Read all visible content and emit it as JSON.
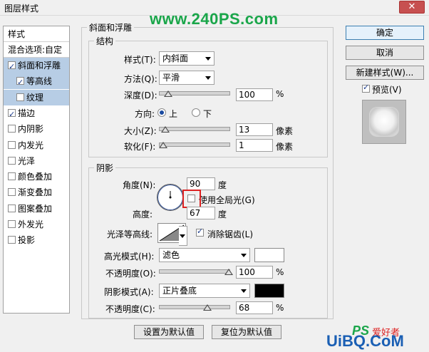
{
  "window": {
    "title": "图层样式",
    "close_label": "✕",
    "watermark_top": "www.240PS.com"
  },
  "left_panel": {
    "header": "样式",
    "blend_options": "混合选项:自定",
    "items": [
      {
        "label": "斜面和浮雕",
        "checked": true,
        "selected": true
      },
      {
        "label": "等高线",
        "checked": true,
        "selected": true
      },
      {
        "label": "纹理",
        "checked": false,
        "selected": true
      },
      {
        "label": "描边",
        "checked": true
      },
      {
        "label": "内阴影",
        "checked": false
      },
      {
        "label": "内发光",
        "checked": false
      },
      {
        "label": "光泽",
        "checked": false
      },
      {
        "label": "颜色叠加",
        "checked": false
      },
      {
        "label": "渐变叠加",
        "checked": false
      },
      {
        "label": "图案叠加",
        "checked": false
      },
      {
        "label": "外发光",
        "checked": false
      },
      {
        "label": "投影",
        "checked": false
      }
    ]
  },
  "bevel": {
    "group_title": "斜面和浮雕",
    "structure_title": "结构",
    "style_label": "样式(T):",
    "style_value": "内斜面",
    "technique_label": "方法(Q):",
    "technique_value": "平滑",
    "depth_label": "深度(D):",
    "depth_value": "100",
    "depth_unit": "%",
    "depth_level": 0.1,
    "direction_label": "方向:",
    "direction_up": "上",
    "direction_down": "下",
    "size_label": "大小(Z):",
    "size_value": "13",
    "size_unit": "像素",
    "size_level": 0.05,
    "soften_label": "软化(F):",
    "soften_value": "1",
    "soften_unit": "像素",
    "soften_level": 0.02
  },
  "shading": {
    "title": "阴影",
    "angle_label": "角度(N):",
    "angle_value": "90",
    "angle_unit": "度",
    "global_light_label": "使用全局光(G)",
    "altitude_label": "高度:",
    "altitude_value": "67",
    "altitude_unit": "度",
    "gloss_label": "光泽等高线:",
    "antialias_label": "消除锯齿(L)",
    "highlight_mode_label": "高光模式(H):",
    "highlight_mode_value": "滤色",
    "highlight_color": "#ffffff",
    "highlight_opacity_label": "不透明度(O):",
    "highlight_opacity_value": "100",
    "highlight_opacity_unit": "%",
    "highlight_opacity_level": 1.0,
    "shadow_mode_label": "阴影模式(A):",
    "shadow_mode_value": "正片叠底",
    "shadow_color": "#000000",
    "shadow_opacity_label": "不透明度(C):",
    "shadow_opacity_value": "68",
    "shadow_opacity_unit": "%",
    "shadow_opacity_level": 0.68
  },
  "bottom_buttons": {
    "set_default": "设置为默认值",
    "reset_default": "复位为默认值"
  },
  "right_panel": {
    "ok": "确定",
    "cancel": "取消",
    "new_style": "新建样式(W)...",
    "preview_label": "预览(V)"
  },
  "watermark_bottom": {
    "ps": "PS",
    "cn": "爱好者",
    "site": "UiBQ.CoM"
  }
}
